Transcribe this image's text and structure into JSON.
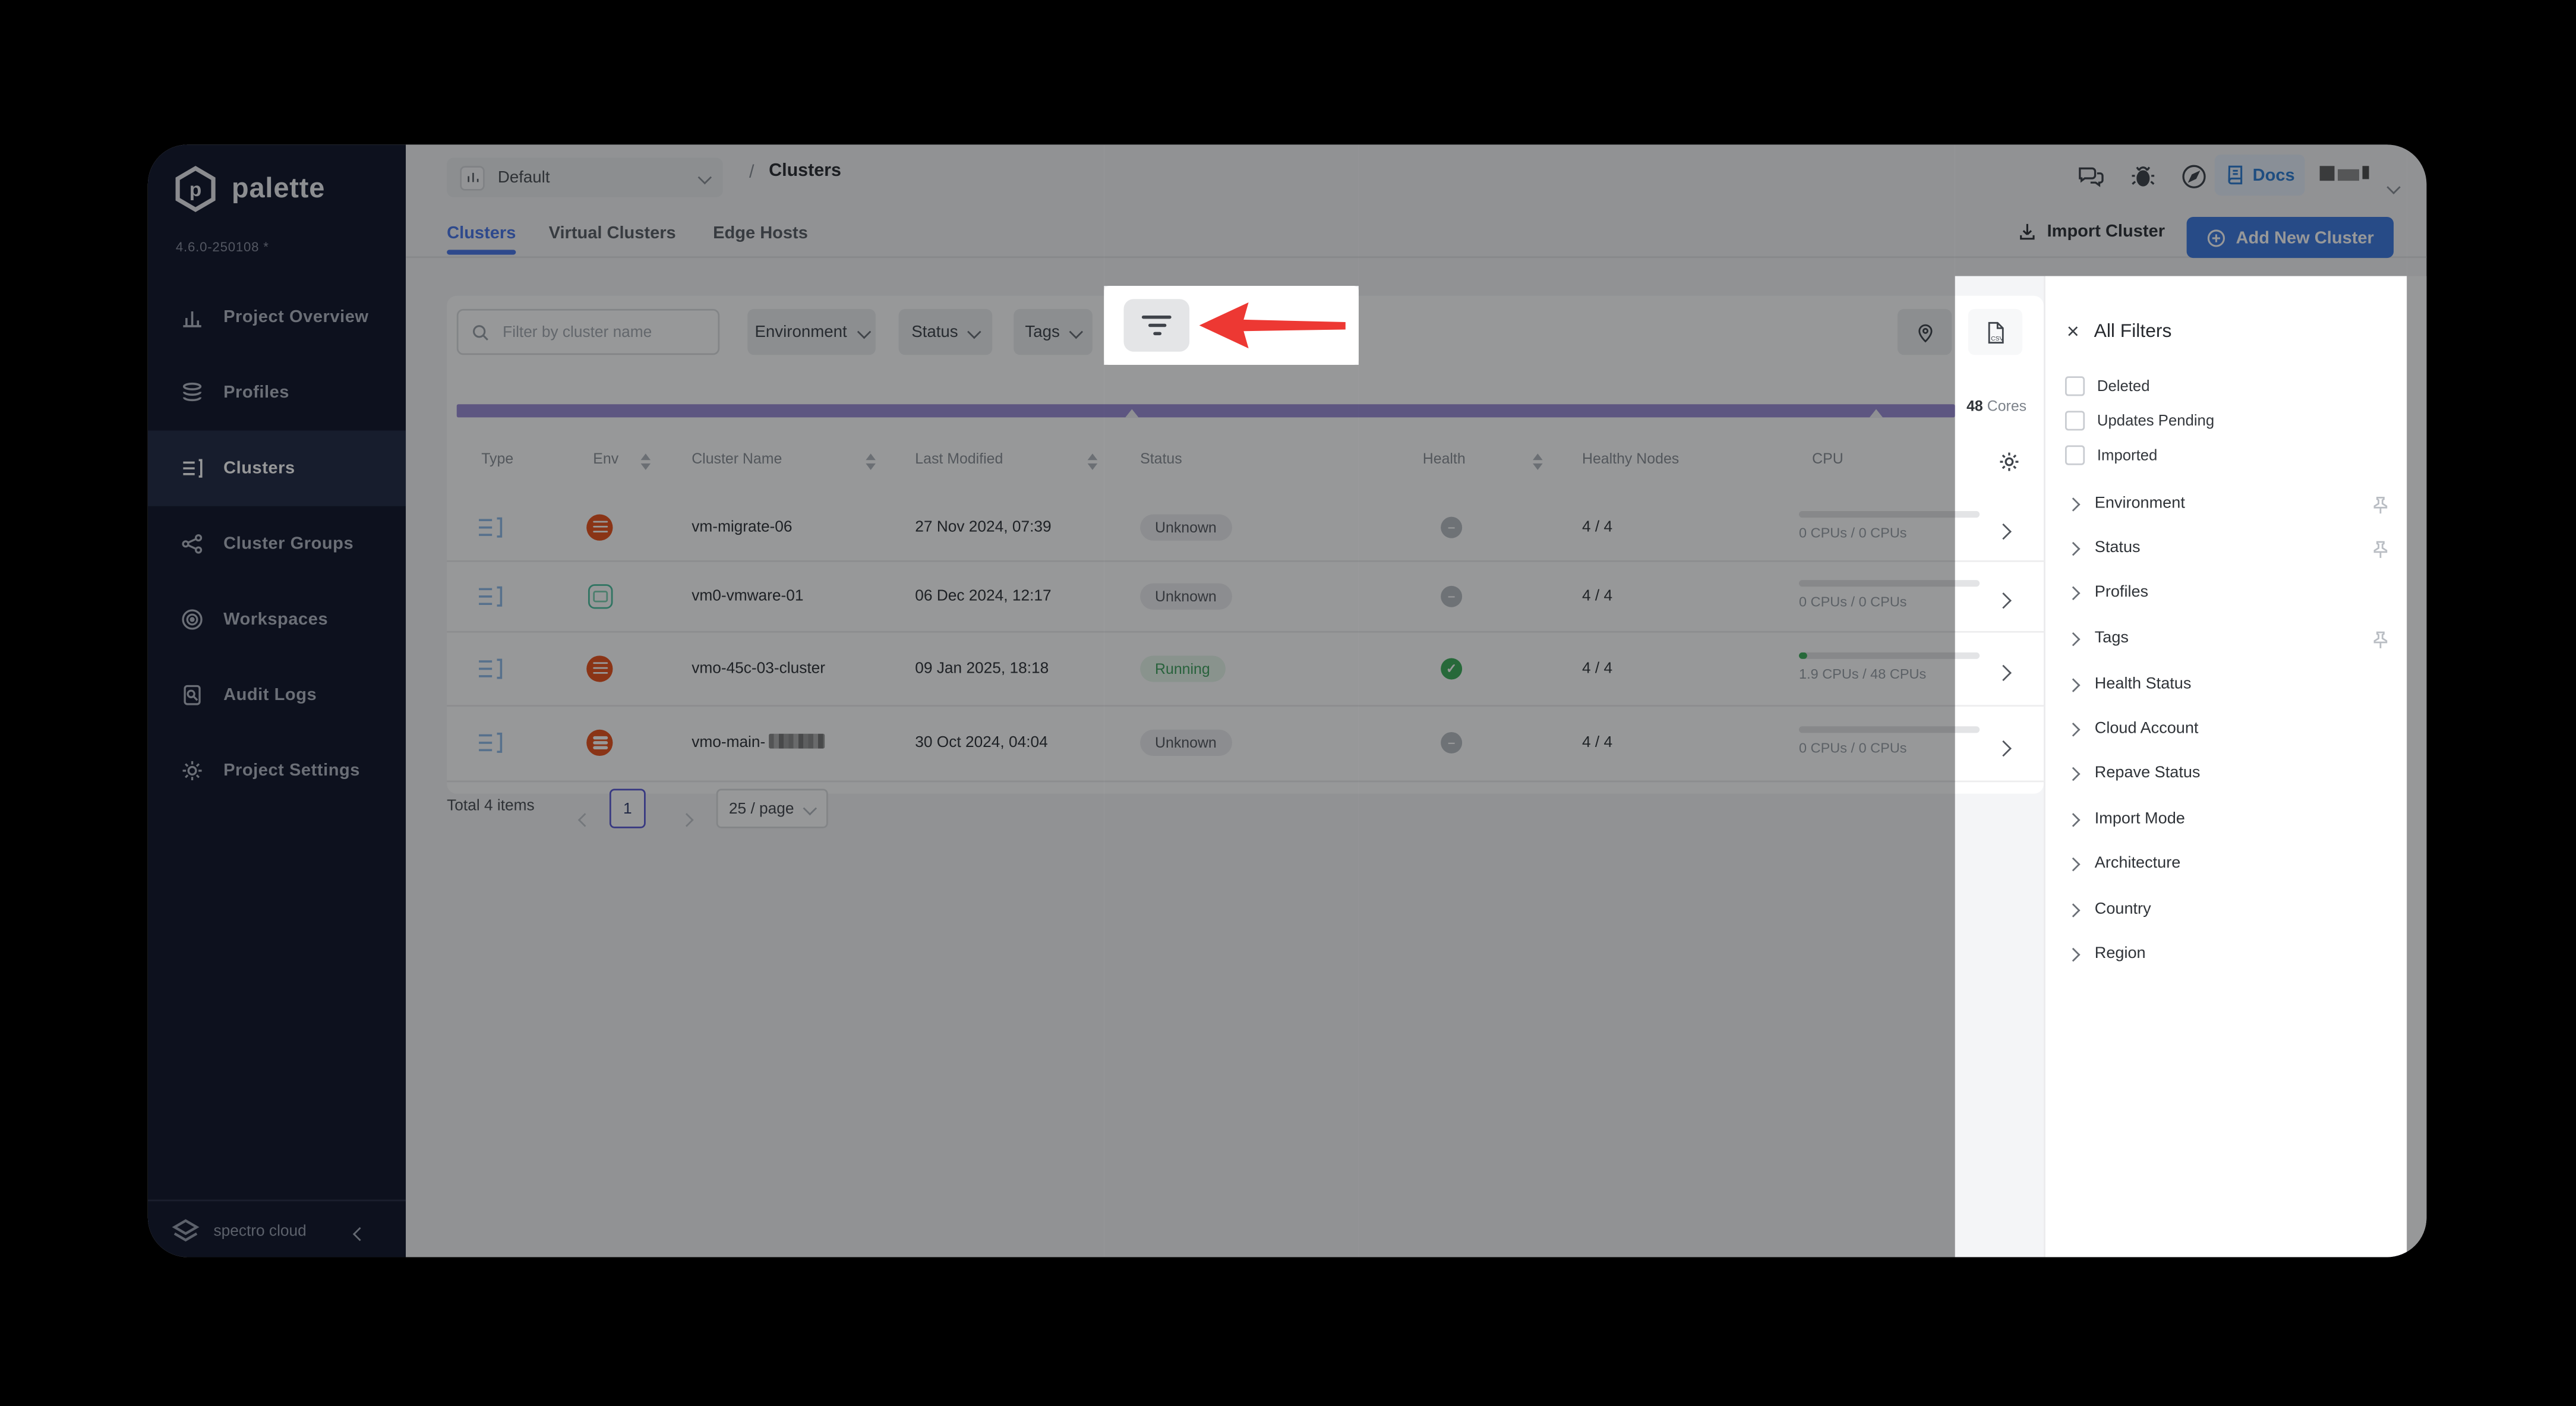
{
  "app": {
    "name": "palette",
    "version": "4.6.0-250108 *",
    "footer_brand": "spectro cloud"
  },
  "sidebar": {
    "items": [
      {
        "label": "Project Overview",
        "active": false
      },
      {
        "label": "Profiles",
        "active": false
      },
      {
        "label": "Clusters",
        "active": true
      },
      {
        "label": "Cluster Groups",
        "active": false
      },
      {
        "label": "Workspaces",
        "active": false
      },
      {
        "label": "Audit Logs",
        "active": false
      },
      {
        "label": "Project Settings",
        "active": false
      }
    ]
  },
  "header": {
    "project_selector": "Default",
    "breadcrumb_separator": "/",
    "page_title": "Clusters",
    "docs_label": "Docs"
  },
  "tabs": [
    {
      "label": "Clusters",
      "active": true
    },
    {
      "label": "Virtual Clusters",
      "active": false
    },
    {
      "label": "Edge Hosts",
      "active": false
    }
  ],
  "toolbar": {
    "import_label": "Import Cluster",
    "add_label": "Add New Cluster"
  },
  "filter_bar": {
    "search_placeholder": "Filter by cluster name",
    "environment": "Environment",
    "status": "Status",
    "tags": "Tags"
  },
  "capacity": {
    "value": "48",
    "unit": "Cores"
  },
  "table": {
    "columns": {
      "type": "Type",
      "env": "Env",
      "name": "Cluster Name",
      "modified": "Last Modified",
      "status": "Status",
      "health": "Health",
      "nodes": "Healthy Nodes",
      "cpu": "CPU"
    },
    "rows": [
      {
        "name": "vm-migrate-06",
        "env": "vsphere",
        "modified": "27 Nov 2024, 07:39",
        "status": "Unknown",
        "health": "unknown",
        "nodes": "4 / 4",
        "cpu": "0 CPUs / 0 CPUs",
        "cpu_pct": 0
      },
      {
        "name": "vm0-vmware-01",
        "env": "virtual",
        "modified": "06 Dec 2024, 12:17",
        "status": "Unknown",
        "health": "unknown",
        "nodes": "4 / 4",
        "cpu": "0 CPUs / 0 CPUs",
        "cpu_pct": 0
      },
      {
        "name": "vmo-45c-03-cluster",
        "env": "vsphere",
        "modified": "09 Jan 2025, 18:18",
        "status": "Running",
        "health": "healthy",
        "nodes": "4 / 4",
        "cpu": "1.9 CPUs / 48 CPUs",
        "cpu_pct": 4
      },
      {
        "name": "vmo-main-",
        "name_redacted": true,
        "env": "vsphere",
        "modified": "30 Oct 2024, 04:04",
        "status": "Unknown",
        "health": "unknown",
        "nodes": "4 / 4",
        "cpu": "0 CPUs / 0 CPUs",
        "cpu_pct": 0
      }
    ]
  },
  "pagination": {
    "total": "Total 4 items",
    "page": "1",
    "per_page": "25 / page"
  },
  "filters_panel": {
    "title": "All Filters",
    "checkboxes": [
      {
        "label": "Deleted",
        "checked": false
      },
      {
        "label": "Updates Pending",
        "checked": false
      },
      {
        "label": "Imported",
        "checked": false
      }
    ],
    "sections": [
      {
        "label": "Environment",
        "pinned": true
      },
      {
        "label": "Status",
        "pinned": true
      },
      {
        "label": "Profiles",
        "pinned": false
      },
      {
        "label": "Tags",
        "pinned": true
      },
      {
        "label": "Health Status",
        "pinned": false
      },
      {
        "label": "Cloud Account",
        "pinned": false
      },
      {
        "label": "Repave Status",
        "pinned": false
      },
      {
        "label": "Import Mode",
        "pinned": false
      },
      {
        "label": "Architecture",
        "pinned": false
      },
      {
        "label": "Country",
        "pinned": false
      },
      {
        "label": "Region",
        "pinned": false
      }
    ]
  },
  "colors": {
    "accent_blue": "#3f7ae0",
    "tab_blue": "#4a78e8",
    "docs_blue": "#2f7fd4",
    "running_green": "#41a25f",
    "healthy_green": "#3fae5c",
    "arrow_red": "#ed3833",
    "capacity_purple": "#9b8ed6",
    "env_vsphere_orange": "#e8541e",
    "env_teal": "#4fc2a0",
    "sidebar_bg": "#12172b",
    "page_bg": "#f4f5f7"
  },
  "icons": {
    "bar-chart-icon": "mini bar chart",
    "layers-icon": "stacked layers",
    "cluster-list-icon": "list with bracket",
    "network-icon": "linked nodes",
    "workspaces-icon": "concentric circles",
    "audit-icon": "document with magnifier",
    "gear-icon": "cog",
    "chat-icon": "speech bubbles",
    "bug-icon": "bug",
    "compass-icon": "compass",
    "book-icon": "book",
    "import-icon": "download into tray",
    "plus-circle-icon": "plus in circle",
    "search-icon": "magnifier",
    "filter-icon": "three shrinking bars",
    "location-pin-icon": "map pin",
    "csv-export-icon": "csv file",
    "pin-icon": "pushpin",
    "close-icon": "x",
    "check-icon": "check",
    "minus-icon": "dash",
    "chevron-down-icon": "v",
    "chevron-right-icon": ">",
    "chevron-left-icon": "<",
    "hexagon-logo": "palette hexagon",
    "spectro-logo": "spectro cloud mark",
    "red-arrow-annotation": "left-pointing arrow"
  }
}
